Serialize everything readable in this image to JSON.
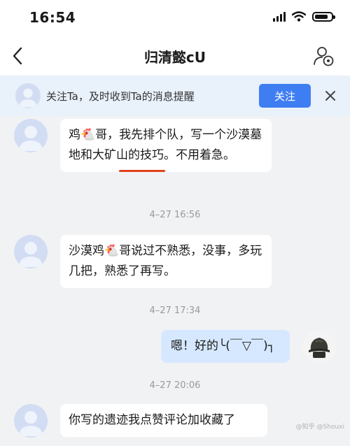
{
  "status_bar": {
    "time": "16:54"
  },
  "header": {
    "title": "归清懿cU"
  },
  "follow_banner": {
    "text": "关注Ta，及时收到Ta的消息提醒",
    "follow_button": "关注"
  },
  "messages": [
    {
      "sender": "other",
      "text": "鸡🐔哥，我先排个队，写一个沙漠墓地和大矿山的技巧。不用着急。",
      "underlined": "大矿山的"
    },
    {
      "type": "timestamp",
      "text": "4–27 16:56"
    },
    {
      "sender": "other",
      "text": "沙漠鸡🐔哥说过不熟悉，没事，多玩几把，熟悉了再写。"
    },
    {
      "type": "timestamp",
      "text": "4–27 17:34"
    },
    {
      "sender": "self",
      "text": "嗯！好的╰(￣▽￣)┐"
    },
    {
      "type": "timestamp",
      "text": "4–27 20:06"
    },
    {
      "sender": "other",
      "text": "你写的遗迹我点赞评论加收藏了"
    }
  ],
  "colors": {
    "accent": "#3f7ef2",
    "self_bubble": "#d6e8ff",
    "underline": "#e2421b"
  },
  "icons": [
    "signal-icon",
    "wifi-icon",
    "battery-icon",
    "back-icon",
    "user-settings-icon",
    "close-icon",
    "default-avatar-icon"
  ],
  "watermark": "@知乎 @Shouxi"
}
